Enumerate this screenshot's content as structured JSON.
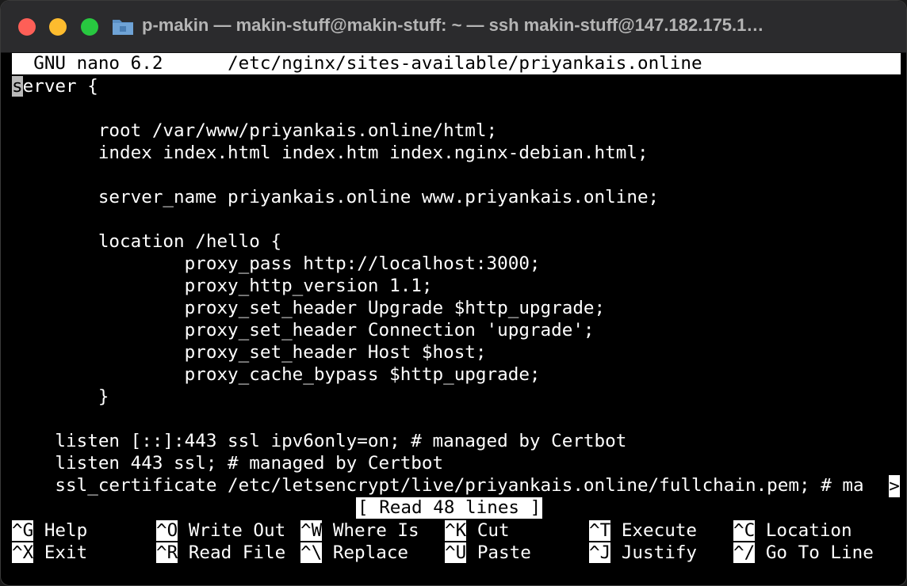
{
  "window": {
    "title": "p-makin — makin-stuff@makin-stuff: ~ — ssh makin-stuff@147.182.175.1…"
  },
  "nano": {
    "version": "GNU nano 6.2",
    "file": "/etc/nginx/sites-available/priyankais.online",
    "status": "[ Read 48 lines ]",
    "overflow_marker": ">"
  },
  "buffer": {
    "lines": [
      "server {",
      "",
      "        root /var/www/priyankais.online/html;",
      "        index index.html index.htm index.nginx-debian.html;",
      "",
      "        server_name priyankais.online www.priyankais.online;",
      "",
      "        location /hello {",
      "                proxy_pass http://localhost:3000;",
      "                proxy_http_version 1.1;",
      "                proxy_set_header Upgrade $http_upgrade;",
      "                proxy_set_header Connection 'upgrade';",
      "                proxy_set_header Host $host;",
      "                proxy_cache_bypass $http_upgrade;",
      "        }",
      "",
      "    listen [::]:443 ssl ipv6only=on; # managed by Certbot",
      "    listen 443 ssl; # managed by Certbot",
      "    ssl_certificate /etc/letsencrypt/live/priyankais.online/fullchain.pem; # ma"
    ]
  },
  "shortcuts": {
    "row1": [
      {
        "key": "^G",
        "label": "Help"
      },
      {
        "key": "^O",
        "label": "Write Out"
      },
      {
        "key": "^W",
        "label": "Where Is"
      },
      {
        "key": "^K",
        "label": "Cut"
      },
      {
        "key": "^T",
        "label": "Execute"
      },
      {
        "key": "^C",
        "label": "Location"
      }
    ],
    "row2": [
      {
        "key": "^X",
        "label": "Exit"
      },
      {
        "key": "^R",
        "label": "Read File"
      },
      {
        "key": "^\\",
        "label": "Replace"
      },
      {
        "key": "^U",
        "label": "Paste"
      },
      {
        "key": "^J",
        "label": "Justify"
      },
      {
        "key": "^/",
        "label": "Go To Line"
      }
    ]
  },
  "colors": {
    "red_light": "#fe5f57",
    "yellow_light": "#febc2e",
    "green_light": "#28c840",
    "terminal_bg": "#000000",
    "terminal_fg": "#ffffff"
  }
}
